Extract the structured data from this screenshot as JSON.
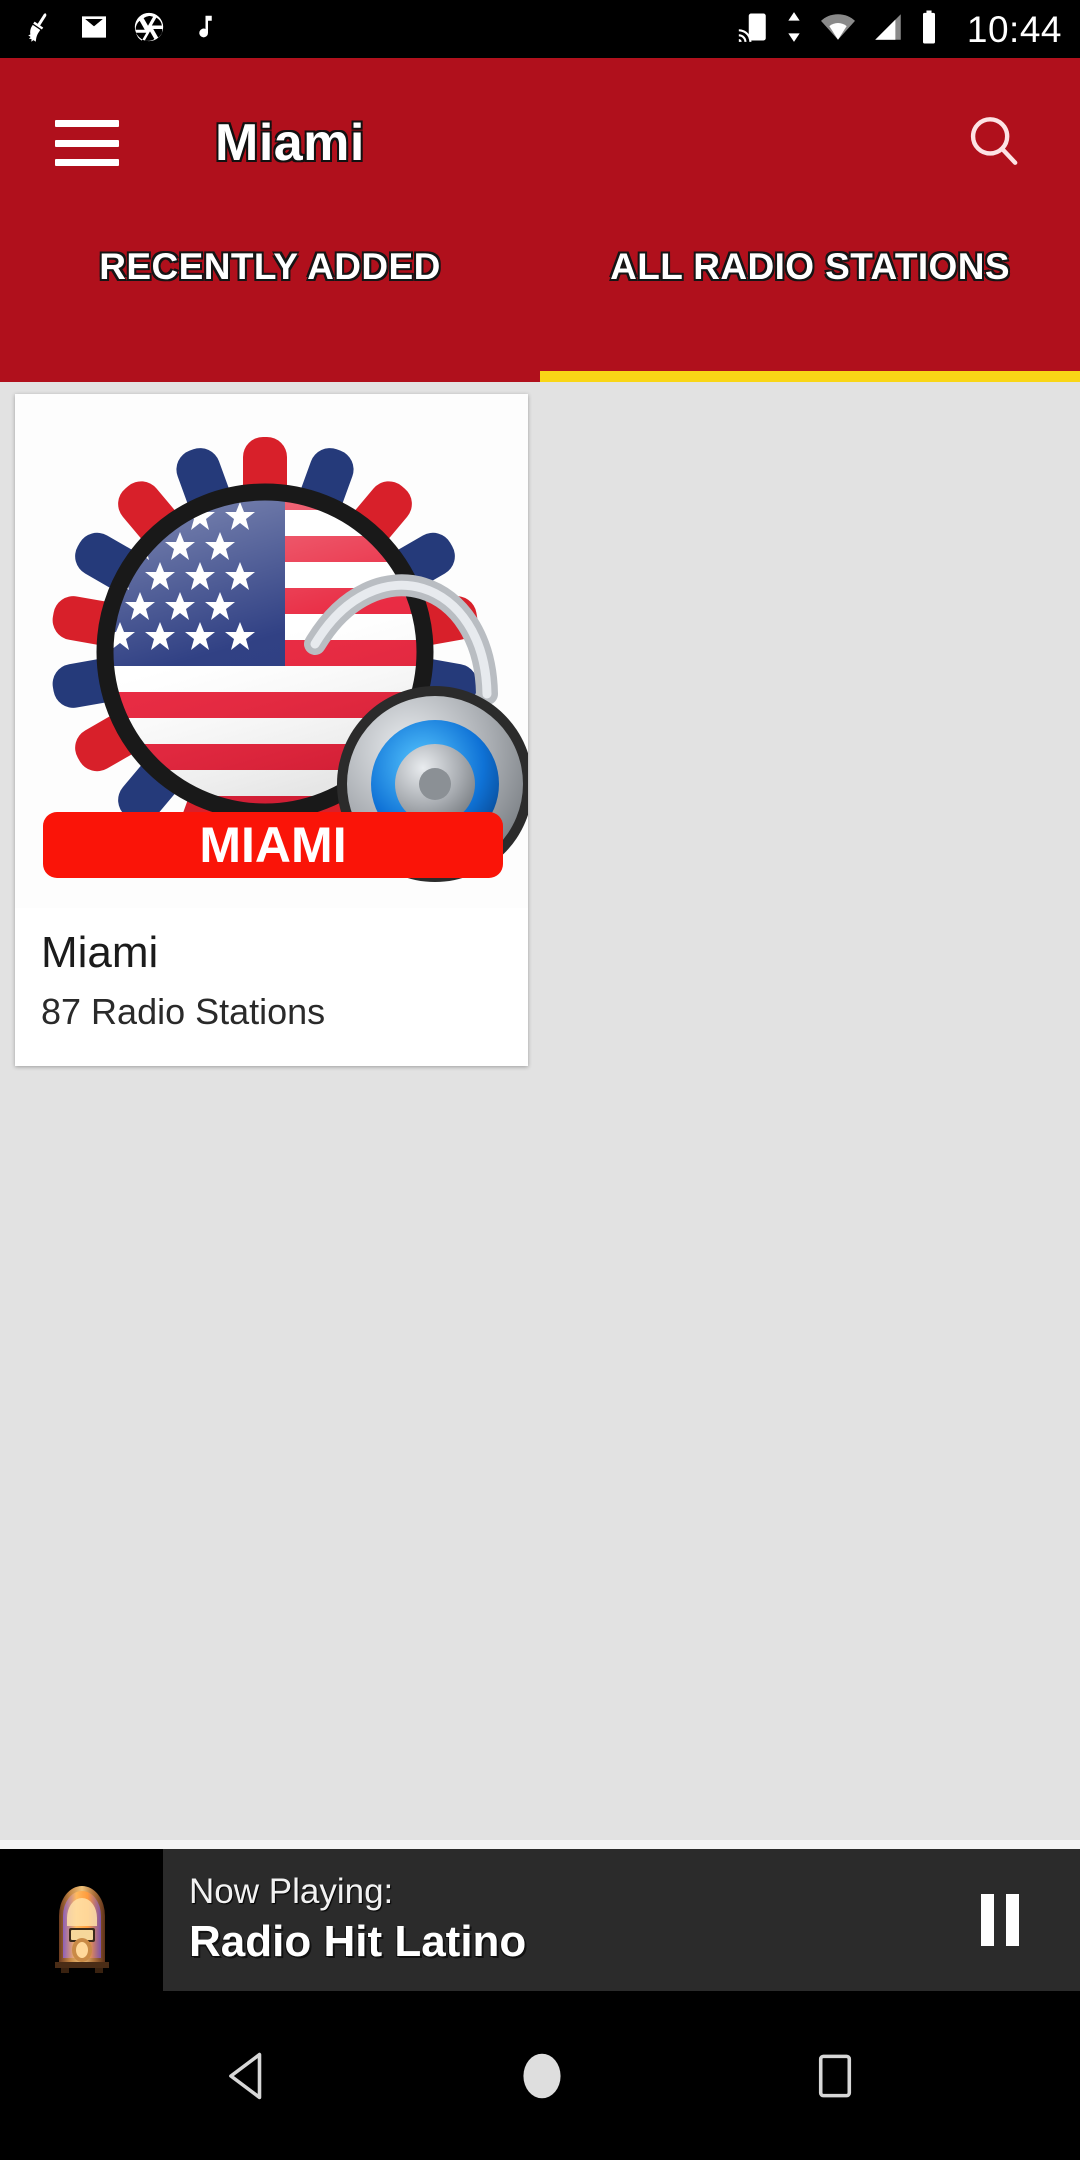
{
  "status_bar": {
    "icons_left": [
      "broom-clean-icon",
      "gmail-icon",
      "camera-shutter-icon",
      "music-note-icon"
    ],
    "icons_right": [
      "cast-screen-icon",
      "sync-arrows-icon",
      "wifi-icon",
      "cellular-signal-icon",
      "battery-icon"
    ],
    "clock": "10:44"
  },
  "app_bar": {
    "menu_icon": "hamburger-menu-icon",
    "title": "Miami",
    "search_icon": "search-icon",
    "background_color": "#b0101c"
  },
  "tabs": {
    "indicator_color": "#f9d616",
    "items": [
      {
        "label": "RECENTLY ADDED",
        "selected": false
      },
      {
        "label": "ALL RADIO STATIONS",
        "selected": true
      }
    ]
  },
  "content": {
    "background_color": "#e2e2e2",
    "cards": [
      {
        "title": "Miami",
        "subtitle": "87 Radio Stations",
        "thumb_banner_text": "MIAMI",
        "thumb_banner_color": "#fa1408",
        "thumb_icon": "usa-flag-radio-headphones-icon"
      }
    ]
  },
  "player": {
    "thumb_icon": "jukebox-icon",
    "now_playing_label": "Now Playing:",
    "station_name": "Radio Hit Latino",
    "control_icon": "pause-icon",
    "background_color": "#2b2b2b"
  },
  "nav_bar": {
    "back_icon": "back-triangle-icon",
    "home_icon": "home-circle-icon",
    "recents_icon": "recents-square-icon"
  }
}
